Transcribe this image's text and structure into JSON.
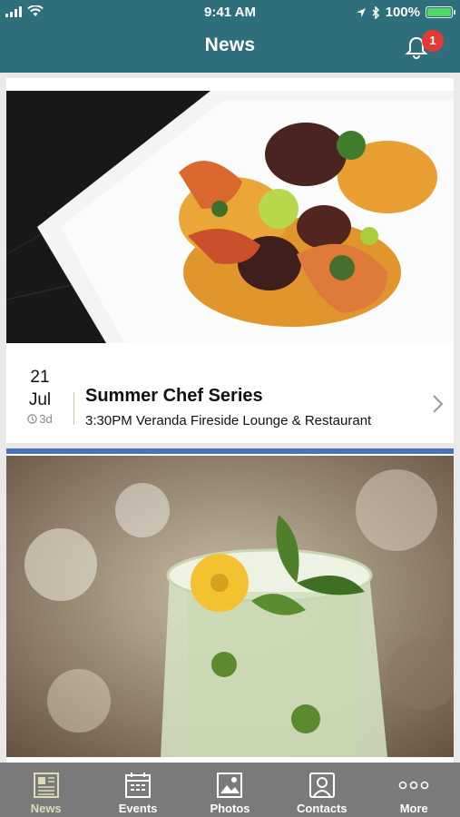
{
  "status_bar": {
    "time": "9:41 AM",
    "battery": "100%",
    "battery_level": 1.0
  },
  "header": {
    "title": "News",
    "notification_count": "1"
  },
  "feed": {
    "items": [
      {
        "day": "21",
        "month": "Jul",
        "age": "3d",
        "title": "Summer Chef Series",
        "subtitle": "3:30PM Veranda Fireside Lounge & Restaurant",
        "image": "plated-shrimp-risotto-photo"
      },
      {
        "image": "cocktail-with-flower-photo"
      }
    ]
  },
  "tabbar": {
    "tabs": [
      {
        "label": "News",
        "icon": "newspaper-icon",
        "active": true
      },
      {
        "label": "Events",
        "icon": "calendar-icon",
        "active": false
      },
      {
        "label": "Photos",
        "icon": "photo-icon",
        "active": false
      },
      {
        "label": "Contacts",
        "icon": "contact-card-icon",
        "active": false
      },
      {
        "label": "More",
        "icon": "more-dots-icon",
        "active": false
      }
    ]
  },
  "colors": {
    "header_bg": "#2e6f7b",
    "badge": "#e53935",
    "tabbar_bg": "#7a7a7a",
    "tab_active": "#dcdcb4",
    "card_accent": "#4a72b8"
  }
}
